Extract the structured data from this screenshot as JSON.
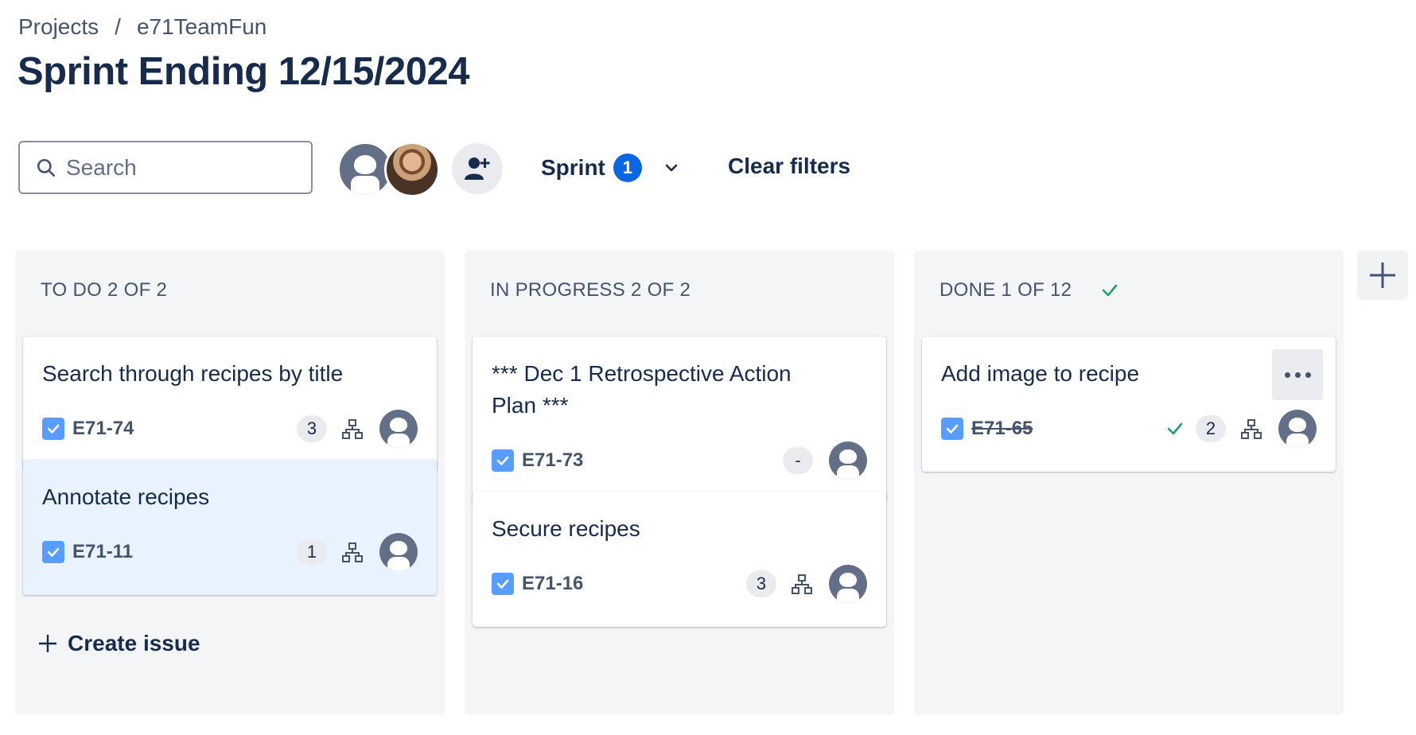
{
  "breadcrumb": {
    "root": "Projects",
    "separator": "/",
    "project": "e71TeamFun"
  },
  "page": {
    "title": "Sprint Ending 12/15/2024"
  },
  "toolbar": {
    "search_placeholder": "Search",
    "sprint_label": "Sprint",
    "sprint_count": "1",
    "clear_filters": "Clear filters"
  },
  "colors": {
    "accent": "#0c66e4",
    "done_green": "#22a06b",
    "checkbox": "#579dff",
    "avatar": "#626f86"
  },
  "columns": [
    {
      "header": "TO DO 2 OF 2",
      "cards": [
        {
          "title": "Search through recipes by title",
          "key": "E71-74",
          "points": "3",
          "selected": false
        },
        {
          "title": "Annotate recipes",
          "key": "E71-11",
          "points": "1",
          "selected": true
        }
      ],
      "create_label": "Create issue"
    },
    {
      "header": "IN PROGRESS 2 OF 2",
      "cards": [
        {
          "title": "*** Dec 1 Retrospective Action Plan ***",
          "key": "E71-73",
          "points": "-"
        },
        {
          "title": "Secure recipes",
          "key": "E71-16",
          "points": "3"
        }
      ]
    },
    {
      "header": "DONE 1 OF 12",
      "cards": [
        {
          "title": "Add image to recipe",
          "key": "E71-65",
          "points": "2",
          "done": true
        }
      ]
    }
  ]
}
